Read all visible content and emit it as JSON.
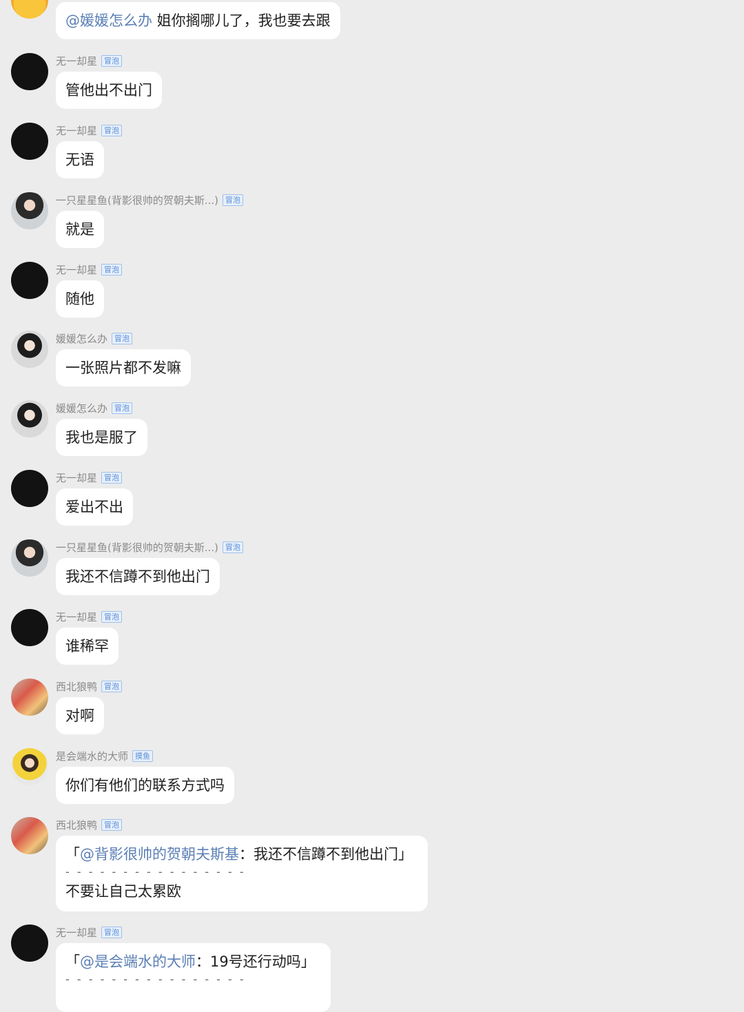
{
  "messages": [
    {
      "avatar_icon": "yellow-bear-avatar-icon",
      "mention": "@媛媛怎么办",
      "text": " 姐你搁哪儿了，我也要去跟"
    },
    {
      "name": "无一却星",
      "badge": "冒泡",
      "avatar_icon": "black-avatar-icon",
      "text": "管他出不出门"
    },
    {
      "name": "无一却星",
      "badge": "冒泡",
      "avatar_icon": "black-avatar-icon",
      "text": "无语"
    },
    {
      "name": "一只星星鱼(背影很帅的贺朝夫斯...)",
      "badge": "冒泡",
      "avatar_icon": "person-avatar-icon",
      "text": "就是"
    },
    {
      "name": "无一却星",
      "badge": "冒泡",
      "avatar_icon": "black-avatar-icon",
      "text": "随他"
    },
    {
      "name": "媛媛怎么办",
      "badge": "冒泡",
      "avatar_icon": "girl-avatar-icon",
      "text": "一张照片都不发嘛"
    },
    {
      "name": "媛媛怎么办",
      "badge": "冒泡",
      "avatar_icon": "girl-avatar-icon",
      "text": "我也是服了"
    },
    {
      "name": "无一却星",
      "badge": "冒泡",
      "avatar_icon": "black-avatar-icon",
      "text": "爱出不出"
    },
    {
      "name": "一只星星鱼(背影很帅的贺朝夫斯...)",
      "badge": "冒泡",
      "avatar_icon": "person-avatar-icon",
      "text": "我还不信蹲不到他出门"
    },
    {
      "name": "无一却星",
      "badge": "冒泡",
      "avatar_icon": "black-avatar-icon",
      "text": "谁稀罕"
    },
    {
      "name": "西北狼鸭",
      "badge": "冒泡",
      "avatar_icon": "colorful-avatar-icon",
      "text": "对啊"
    },
    {
      "name": "是会端水的大师",
      "badge": "摸鱼",
      "avatar_icon": "child-avatar-icon",
      "text": "你们有他们的联系方式吗"
    },
    {
      "name": "西北狼鸭",
      "badge": "冒泡",
      "avatar_icon": "colorful-avatar-icon",
      "quote_open": "「",
      "quote_mention": "@背影很帅的贺朝夫斯基",
      "quote_text": "：我还不信蹲不到他出门」",
      "divider": "- - - - - - - - - - - - - - - -",
      "reply": "不要让自己太累欧"
    },
    {
      "name": "无一却星",
      "badge": "冒泡",
      "avatar_icon": "black-avatar-icon",
      "quote_open": "「",
      "quote_mention": "@是会端水的大师",
      "quote_text": "：19号还行动吗」",
      "divider": "- - - - - - - - - - - - - - - -"
    }
  ]
}
